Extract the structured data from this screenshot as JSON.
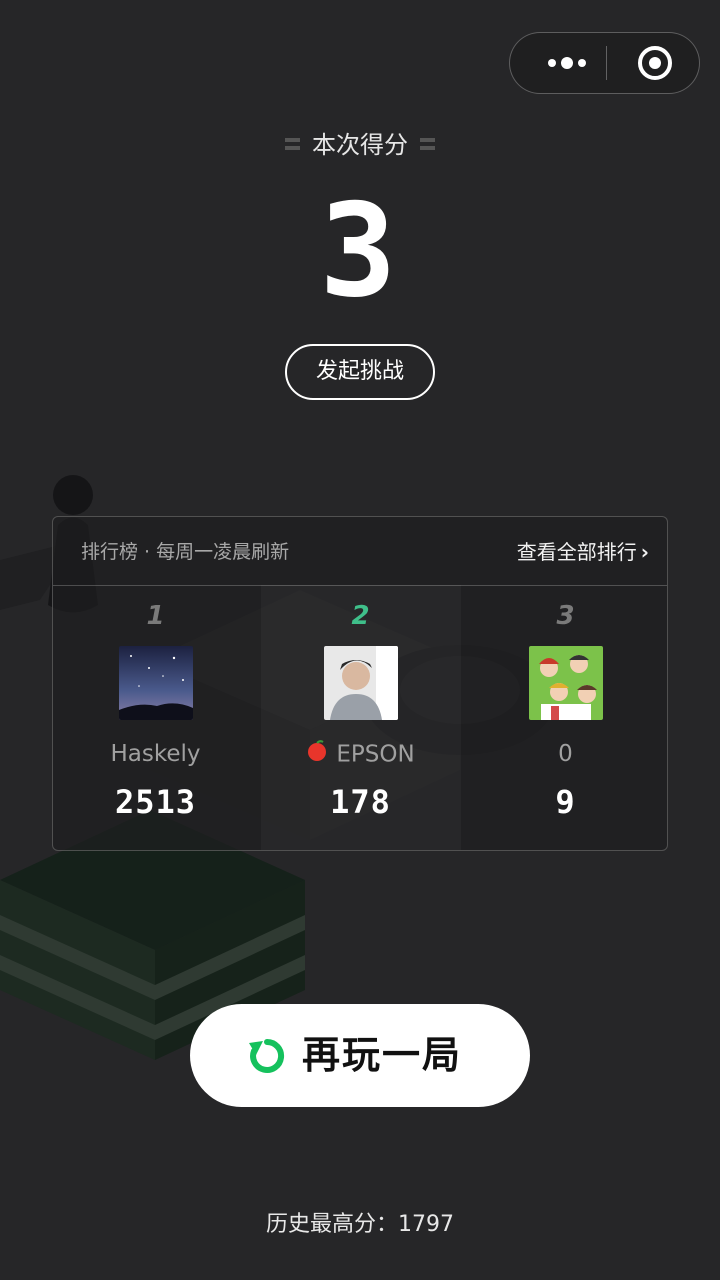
{
  "capsule": {
    "more_icon": "more-dots-icon",
    "close_icon": "target-close-icon"
  },
  "score": {
    "title": "本次得分",
    "value": "3"
  },
  "challenge": {
    "label": "发起挑战"
  },
  "leaderboard": {
    "title": "排行榜 · 每周一凌晨刷新",
    "view_all": "查看全部排行",
    "view_all_icon": "chevron-right-icon",
    "entries": [
      {
        "rank": "1",
        "name": "Haskely",
        "score": "2513",
        "avatar": "starry-sky-avatar"
      },
      {
        "rank": "2",
        "name": "EPSON",
        "score": "178",
        "avatar": "person-avatar",
        "badge": "apple-icon",
        "highlight": true
      },
      {
        "rank": "3",
        "name": "0",
        "score": "9",
        "avatar": "anime-avatar"
      }
    ]
  },
  "replay": {
    "label": "再玩一局",
    "icon": "replay-icon",
    "accent": "#15c15d"
  },
  "history": {
    "label": "历史最高分：",
    "value": "1797"
  },
  "colors": {
    "background": "#262628",
    "rank_highlight": "#3fbf8a",
    "rank_default": "#7a7a7a"
  }
}
